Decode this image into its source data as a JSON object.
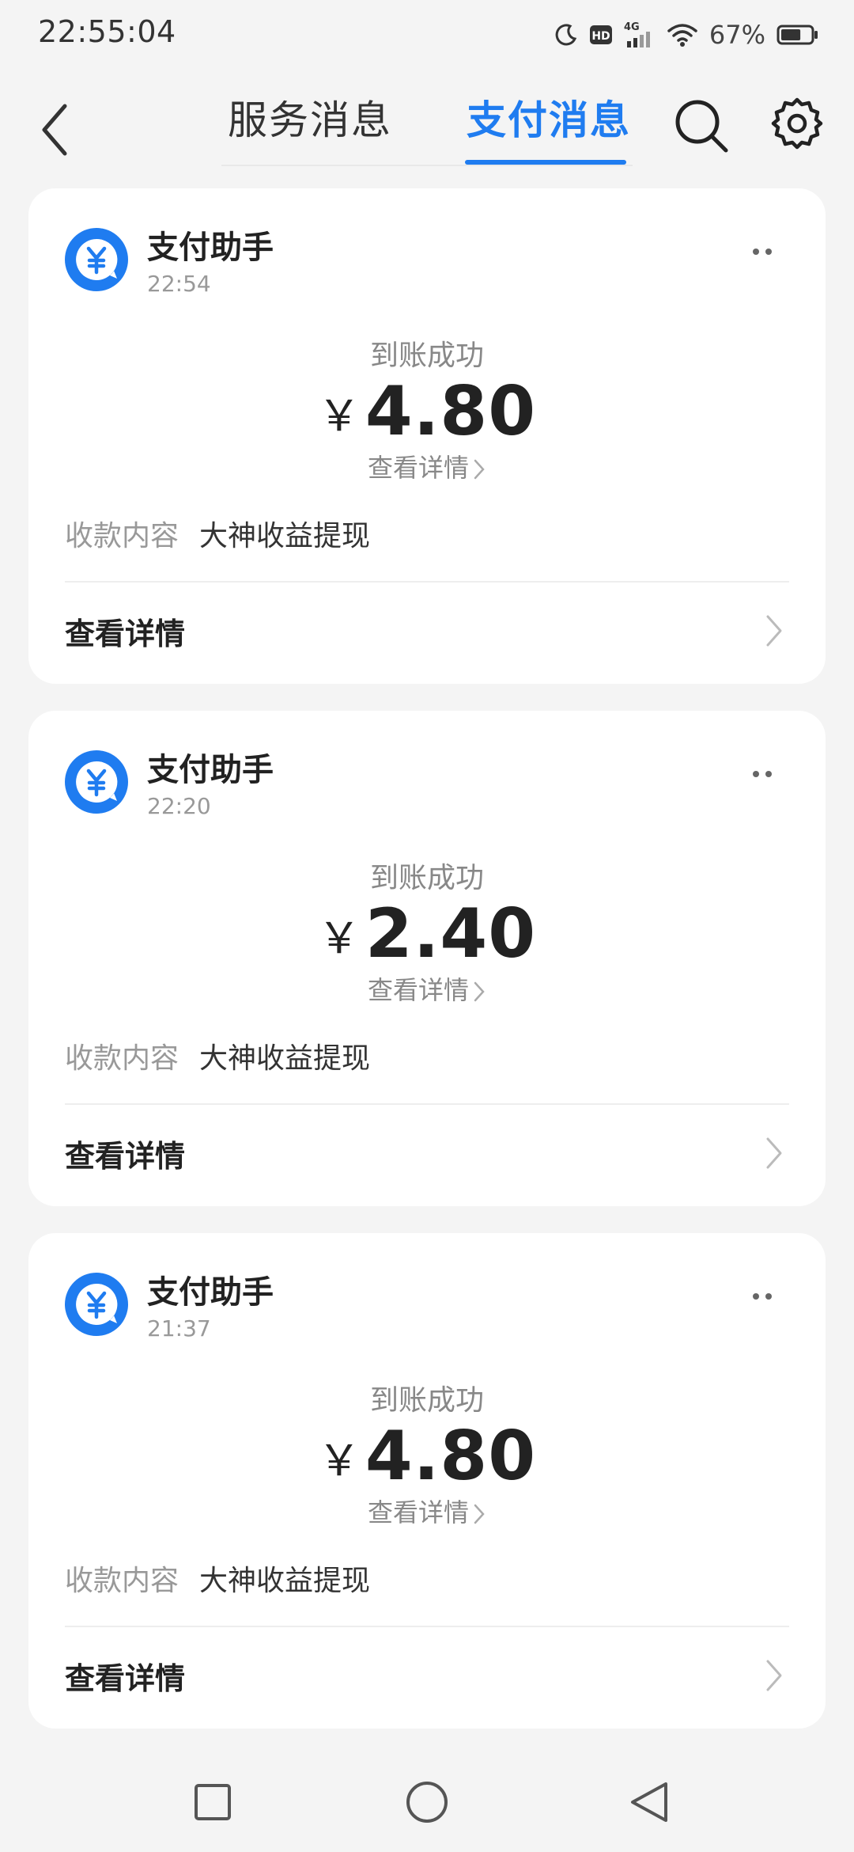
{
  "status_bar": {
    "time": "22:55:04",
    "battery_percent": "67%",
    "network": "4G",
    "hd_badge": "HD",
    "icons": [
      "moon-icon",
      "hd-icon",
      "signal-4g-icon",
      "wifi-icon",
      "battery-icon"
    ],
    "battery_level": 0.67
  },
  "header": {
    "tabs": [
      {
        "label": "服务消息",
        "active": false
      },
      {
        "label": "支付消息",
        "active": true
      }
    ],
    "icons": [
      "back-arrow-icon",
      "search-icon",
      "settings-gear-icon"
    ],
    "accent_color": "#1f7cf0"
  },
  "messages": [
    {
      "sender": "支付助手",
      "time": "22:54",
      "status": "到账成功",
      "currency": "￥",
      "amount": "4.80",
      "detail_link": "查看详情",
      "content_label": "收款内容",
      "content_value": "大神收益提现",
      "view_detail": "查看详情"
    },
    {
      "sender": "支付助手",
      "time": "22:20",
      "status": "到账成功",
      "currency": "￥",
      "amount": "2.40",
      "detail_link": "查看详情",
      "content_label": "收款内容",
      "content_value": "大神收益提现",
      "view_detail": "查看详情"
    },
    {
      "sender": "支付助手",
      "time": "21:37",
      "status": "到账成功",
      "currency": "￥",
      "amount": "4.80",
      "detail_link": "查看详情",
      "content_label": "收款内容",
      "content_value": "大神收益提现",
      "view_detail": "查看详情"
    }
  ],
  "system_nav": {
    "icons": [
      "recent-apps-square-icon",
      "home-circle-icon",
      "back-triangle-icon"
    ]
  }
}
